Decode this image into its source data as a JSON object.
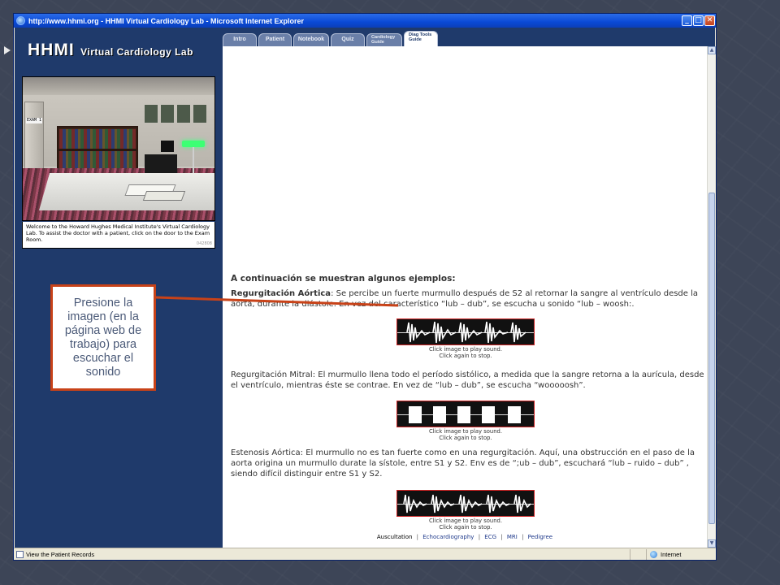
{
  "window": {
    "title": "http://www.hhmi.org - HHMI Virtual Cardiology Lab - Microsoft Internet Explorer",
    "buttons": {
      "minimize": "_",
      "maximize": "□",
      "close": "✕"
    }
  },
  "left_panel": {
    "brand_big": "HHMI",
    "brand_small": "Virtual Cardiology Lab",
    "door_sign": "EXAM 1",
    "welcome_text": "Welcome to the Howard Hughes Medical Institute's Virtual Cardiology Lab.  To assist the doctor with a patient, click on the door to the Exam Room.",
    "image_code": "042808"
  },
  "tabs": [
    {
      "label": "Intro",
      "active": false
    },
    {
      "label": "Patient",
      "active": false
    },
    {
      "label": "Notebook",
      "active": false
    },
    {
      "label": "Quiz",
      "active": false
    },
    {
      "label_line1": "Cardiology",
      "label_line2": "Guide",
      "active": false
    },
    {
      "label_line1": "Diag Tools",
      "label_line2": "Guide",
      "active": true
    }
  ],
  "content": {
    "intro_heading": "A continuación se muestran algunos ejemplos:",
    "examples": [
      {
        "name": "Regurgitación Aórtica",
        "text": ": Se percibe un fuerte murmullo después de S2 al retornar la sangre al ventrículo desde la aorta, durante la diástole.  En vez del característico “lub – dub”, se escucha u sonido “lub – woosh:."
      },
      {
        "text": "Regurgitación Mitral: El murmullo llena todo el período sistólico, a medida que la sangre retorna a la aurícula, desde el ventrículo, mientras éste se contrae. En vez de “lub – dub”, se escucha “wooooosh”."
      },
      {
        "text": "Estenosis Aórtica: El murmullo no es tan fuerte como en una regurgitación.  Aquí, una obstrucción en el paso de la aorta origina un murmullo durate la sístole, entre S1 y S2. Env es de “;ub – dub”, escuchará “lub – ruido – dub” , siendo difícil distinguir entre S1 y S2."
      }
    ],
    "sound_caption_line1": "Click image to play sound.",
    "sound_caption_line2": "Click again to stop."
  },
  "footer_nav": {
    "items": [
      "Auscultation",
      "Echocardiography",
      "ECG",
      "MRI",
      "Pedigree"
    ],
    "separator": "|"
  },
  "statusbar": {
    "text": "View the Patient Records",
    "zone": "Internet"
  },
  "callout": {
    "text": "Presione la imagen (en la página web de trabajo) para escuchar  el sonido",
    "color": "#c84218"
  }
}
